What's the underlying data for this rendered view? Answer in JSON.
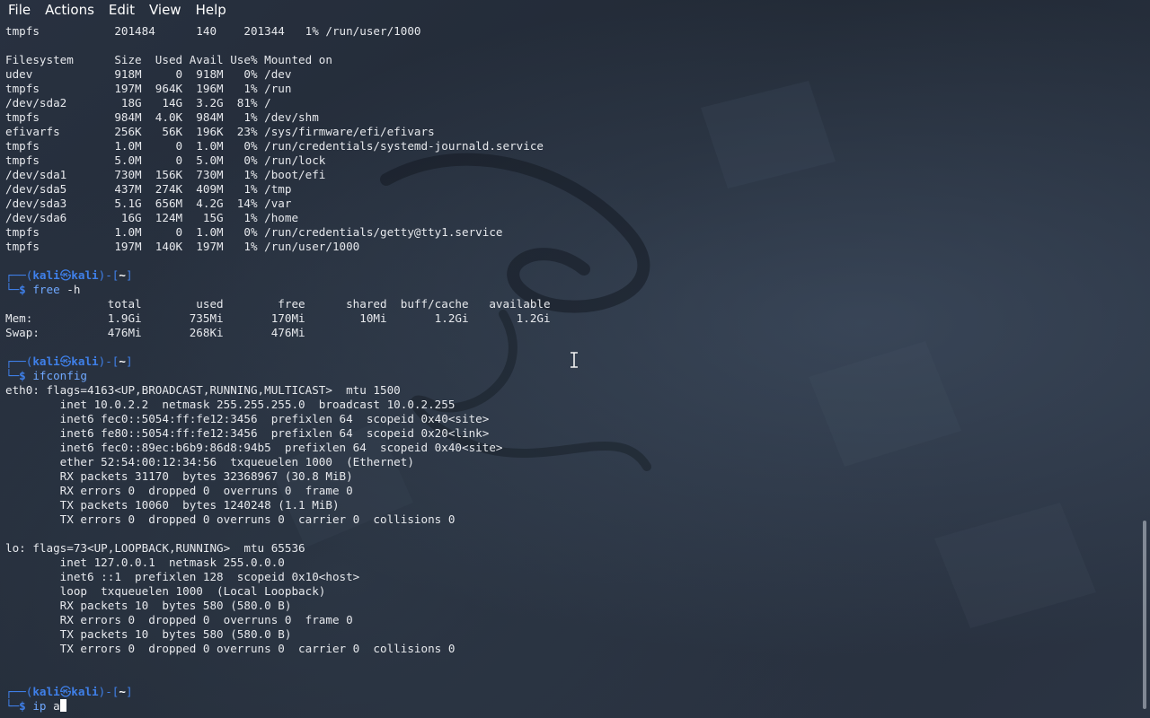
{
  "menubar": {
    "items": [
      "File",
      "Actions",
      "Edit",
      "View",
      "Help"
    ]
  },
  "terminal": {
    "lines": [
      {
        "type": "out",
        "text": "tmpfs           201484      140    201344   1% /run/user/1000"
      },
      {
        "type": "out",
        "text": ""
      },
      {
        "type": "out",
        "text": "Filesystem      Size  Used Avail Use% Mounted on"
      },
      {
        "type": "out",
        "text": "udev            918M     0  918M   0% /dev"
      },
      {
        "type": "out",
        "text": "tmpfs           197M  964K  196M   1% /run"
      },
      {
        "type": "out",
        "text": "/dev/sda2        18G   14G  3.2G  81% /"
      },
      {
        "type": "out",
        "text": "tmpfs           984M  4.0K  984M   1% /dev/shm"
      },
      {
        "type": "out",
        "text": "efivarfs        256K   56K  196K  23% /sys/firmware/efi/efivars"
      },
      {
        "type": "out",
        "text": "tmpfs           1.0M     0  1.0M   0% /run/credentials/systemd-journald.service"
      },
      {
        "type": "out",
        "text": "tmpfs           5.0M     0  5.0M   0% /run/lock"
      },
      {
        "type": "out",
        "text": "/dev/sda1       730M  156K  730M   1% /boot/efi"
      },
      {
        "type": "out",
        "text": "/dev/sda5       437M  274K  409M   1% /tmp"
      },
      {
        "type": "out",
        "text": "/dev/sda3       5.1G  656M  4.2G  14% /var"
      },
      {
        "type": "out",
        "text": "/dev/sda6        16G  124M   15G   1% /home"
      },
      {
        "type": "out",
        "text": "tmpfs           1.0M     0  1.0M   0% /run/credentials/getty@tty1.service"
      },
      {
        "type": "out",
        "text": "tmpfs           197M  140K  197M   1% /run/user/1000"
      },
      {
        "type": "out",
        "text": ""
      },
      {
        "type": "prompt-top",
        "user": "kali",
        "host": "kali",
        "dir": "~"
      },
      {
        "type": "prompt-cmd",
        "cmd": "free",
        "args": " -h"
      },
      {
        "type": "out",
        "text": "               total        used        free      shared  buff/cache   available"
      },
      {
        "type": "out",
        "text": "Mem:           1.9Gi       735Mi       170Mi        10Mi       1.2Gi       1.2Gi"
      },
      {
        "type": "out",
        "text": "Swap:          476Mi       268Ki       476Mi"
      },
      {
        "type": "out",
        "text": ""
      },
      {
        "type": "prompt-top",
        "user": "kali",
        "host": "kali",
        "dir": "~"
      },
      {
        "type": "prompt-cmd",
        "cmd": "ifconfig",
        "args": ""
      },
      {
        "type": "out",
        "text": "eth0: flags=4163<UP,BROADCAST,RUNNING,MULTICAST>  mtu 1500"
      },
      {
        "type": "out",
        "text": "        inet 10.0.2.2  netmask 255.255.255.0  broadcast 10.0.2.255"
      },
      {
        "type": "out",
        "text": "        inet6 fec0::5054:ff:fe12:3456  prefixlen 64  scopeid 0x40<site>"
      },
      {
        "type": "out",
        "text": "        inet6 fe80::5054:ff:fe12:3456  prefixlen 64  scopeid 0x20<link>"
      },
      {
        "type": "out",
        "text": "        inet6 fec0::89ec:b6b9:86d8:94b5  prefixlen 64  scopeid 0x40<site>"
      },
      {
        "type": "out",
        "text": "        ether 52:54:00:12:34:56  txqueuelen 1000  (Ethernet)"
      },
      {
        "type": "out",
        "text": "        RX packets 31170  bytes 32368967 (30.8 MiB)"
      },
      {
        "type": "out",
        "text": "        RX errors 0  dropped 0  overruns 0  frame 0"
      },
      {
        "type": "out",
        "text": "        TX packets 10060  bytes 1240248 (1.1 MiB)"
      },
      {
        "type": "out",
        "text": "        TX errors 0  dropped 0 overruns 0  carrier 0  collisions 0"
      },
      {
        "type": "out",
        "text": ""
      },
      {
        "type": "out",
        "text": "lo: flags=73<UP,LOOPBACK,RUNNING>  mtu 65536"
      },
      {
        "type": "out",
        "text": "        inet 127.0.0.1  netmask 255.0.0.0"
      },
      {
        "type": "out",
        "text": "        inet6 ::1  prefixlen 128  scopeid 0x10<host>"
      },
      {
        "type": "out",
        "text": "        loop  txqueuelen 1000  (Local Loopback)"
      },
      {
        "type": "out",
        "text": "        RX packets 10  bytes 580 (580.0 B)"
      },
      {
        "type": "out",
        "text": "        RX errors 0  dropped 0  overruns 0  frame 0"
      },
      {
        "type": "out",
        "text": "        TX packets 10  bytes 580 (580.0 B)"
      },
      {
        "type": "out",
        "text": "        TX errors 0  dropped 0 overruns 0  carrier 0  collisions 0"
      },
      {
        "type": "out",
        "text": ""
      },
      {
        "type": "out",
        "text": ""
      },
      {
        "type": "prompt-top",
        "user": "kali",
        "host": "kali",
        "dir": "~"
      },
      {
        "type": "prompt-cmd",
        "cmd": "ip",
        "args": " a",
        "cursor": true
      }
    ]
  },
  "colors": {
    "prompt": "#3f80ea",
    "command": "#6fa8ff",
    "text": "#e6e8ec",
    "background": "#1f2733"
  },
  "icons": {
    "prompt_at": "kali-at-icon",
    "cursor": "ibeam-cursor-icon"
  }
}
